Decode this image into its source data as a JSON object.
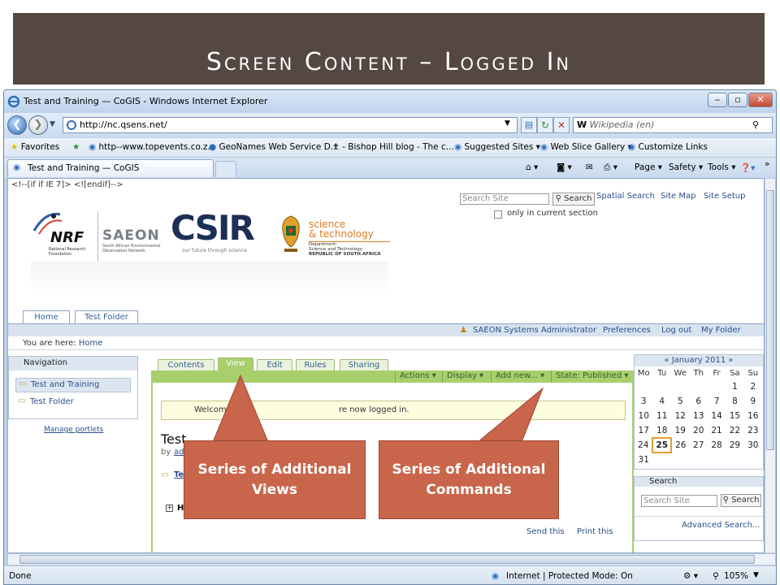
{
  "slide": {
    "title": "Screen Content – Logged In"
  },
  "window": {
    "title": "Test and Training — CoGIS - Windows Internet Explorer",
    "address": "http://nc.qsens.net/",
    "search_placeholder": "Wikipedia (en)",
    "search_prefix": "W"
  },
  "favorites": {
    "label": "Favorites",
    "items": [
      "http--www.topevents.co.z...",
      "GeoNames Web Service D...",
      "- Bishop Hill blog - The c...",
      "Suggested Sites ▾",
      "Web Slice Gallery ▾",
      "Customize Links"
    ]
  },
  "tab": {
    "label": "Test and Training — CoGIS"
  },
  "command_bar": {
    "page": "Page ▾",
    "safety": "Safety ▾",
    "tools": "Tools ▾",
    "help": "❓▾",
    "more": "»"
  },
  "page": {
    "comment_text": "<!--[if if IE 7]> <![endif]-->",
    "search_placeholder": "Search Site",
    "search_button": "Search",
    "top_links": [
      "Spatial Search",
      "Site Map",
      "Site Setup"
    ],
    "only_current": "only in current section",
    "logos": {
      "nrf": "NRF",
      "nrf_sub": "National Research Foundation",
      "saeon": "SAEON",
      "saeon_sub": "South African Environmental Observation Network",
      "csir": "CSIR",
      "csir_sub": "our future through science",
      "dst_line1": "science",
      "dst_line2": "& technology",
      "dst_sub1": "Department:",
      "dst_sub2": "Science and Technology",
      "dst_sub3": "REPUBLIC OF SOUTH AFRICA"
    },
    "top_tabs": [
      "Home",
      "Test Folder"
    ],
    "user_bar": {
      "user": "SAEON Systems Administrator",
      "links": [
        "Preferences",
        "Log out",
        "My Folder"
      ]
    },
    "breadcrumb_label": "You are here:",
    "breadcrumb_link": "Home",
    "navigation": {
      "header": "Navigation",
      "items": [
        "Test and Training",
        "Test Folder"
      ],
      "manage": "Manage portlets"
    },
    "view_tabs": [
      "Contents",
      "View",
      "Edit",
      "Rules",
      "Sharing"
    ],
    "actions": [
      "Actions ▾",
      "Display ▾",
      "Add new... ▾",
      "State: Published ▾"
    ],
    "welcome_left": "Welcom",
    "welcome_right": "re now logged in.",
    "heading_partial": "Test",
    "by_partial": "by",
    "by_link_partial": "adm",
    "folder_link_partial": "Test",
    "history": "History",
    "footer_links": [
      "Send this",
      "Print this"
    ],
    "calendar": {
      "title": "« January 2011 »",
      "days": [
        "Mo",
        "Tu",
        "We",
        "Th",
        "Fr",
        "Sa",
        "Su"
      ],
      "weeks": [
        [
          "",
          "",
          "",
          "",
          "",
          "1",
          "2"
        ],
        [
          "3",
          "4",
          "5",
          "6",
          "7",
          "8",
          "9"
        ],
        [
          "10",
          "11",
          "12",
          "13",
          "14",
          "15",
          "16"
        ],
        [
          "17",
          "18",
          "19",
          "20",
          "21",
          "22",
          "23"
        ],
        [
          "24",
          "25",
          "26",
          "27",
          "28",
          "29",
          "30"
        ],
        [
          "31",
          "",
          "",
          "",
          "",
          "",
          ""
        ]
      ],
      "today": "25"
    },
    "side_search": {
      "header": "Search",
      "placeholder": "Search Site",
      "button": "Search",
      "advanced": "Advanced Search..."
    }
  },
  "callouts": {
    "left": "Series of Additional Views",
    "right": "Series of Additional Commands"
  },
  "status": {
    "left": "Done",
    "zone": "Internet | Protected Mode: On",
    "zoom": "105%"
  },
  "colors": {
    "banner": "#554741",
    "callout": "#c8654a",
    "plone_green": "#a8cf6c"
  }
}
